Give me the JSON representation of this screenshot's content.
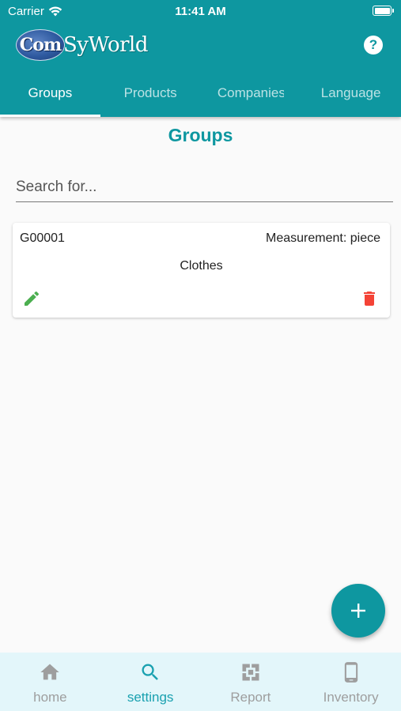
{
  "status_bar": {
    "carrier": "Carrier",
    "time": "11:41 AM"
  },
  "app": {
    "logo_text_a": "Com",
    "logo_text_b": "SyWorld",
    "help_label": "?"
  },
  "tabs": [
    {
      "label": "Groups",
      "active": true
    },
    {
      "label": "Products",
      "active": false
    },
    {
      "label": "Companies",
      "active": false
    },
    {
      "label": "Language",
      "active": false
    }
  ],
  "page": {
    "title": "Groups"
  },
  "search": {
    "placeholder": "Search for...",
    "value": ""
  },
  "groups": [
    {
      "code": "G00001",
      "measurement": "Measurement: piece",
      "name": "Clothes"
    }
  ],
  "fab": {
    "label": "+"
  },
  "bottom_nav": [
    {
      "label": "home",
      "icon": "home-icon",
      "active": false
    },
    {
      "label": "settings",
      "icon": "search-icon",
      "active": true
    },
    {
      "label": "Report",
      "icon": "report-icon",
      "active": false
    },
    {
      "label": "Inventory",
      "icon": "phone-icon",
      "active": false
    }
  ],
  "colors": {
    "primary": "#0e97a0",
    "edit": "#4caf50",
    "delete": "#f44336",
    "nav_bg": "#e3f6fa",
    "nav_active": "#1aa1b0",
    "nav_inactive": "#9e9e9e"
  }
}
